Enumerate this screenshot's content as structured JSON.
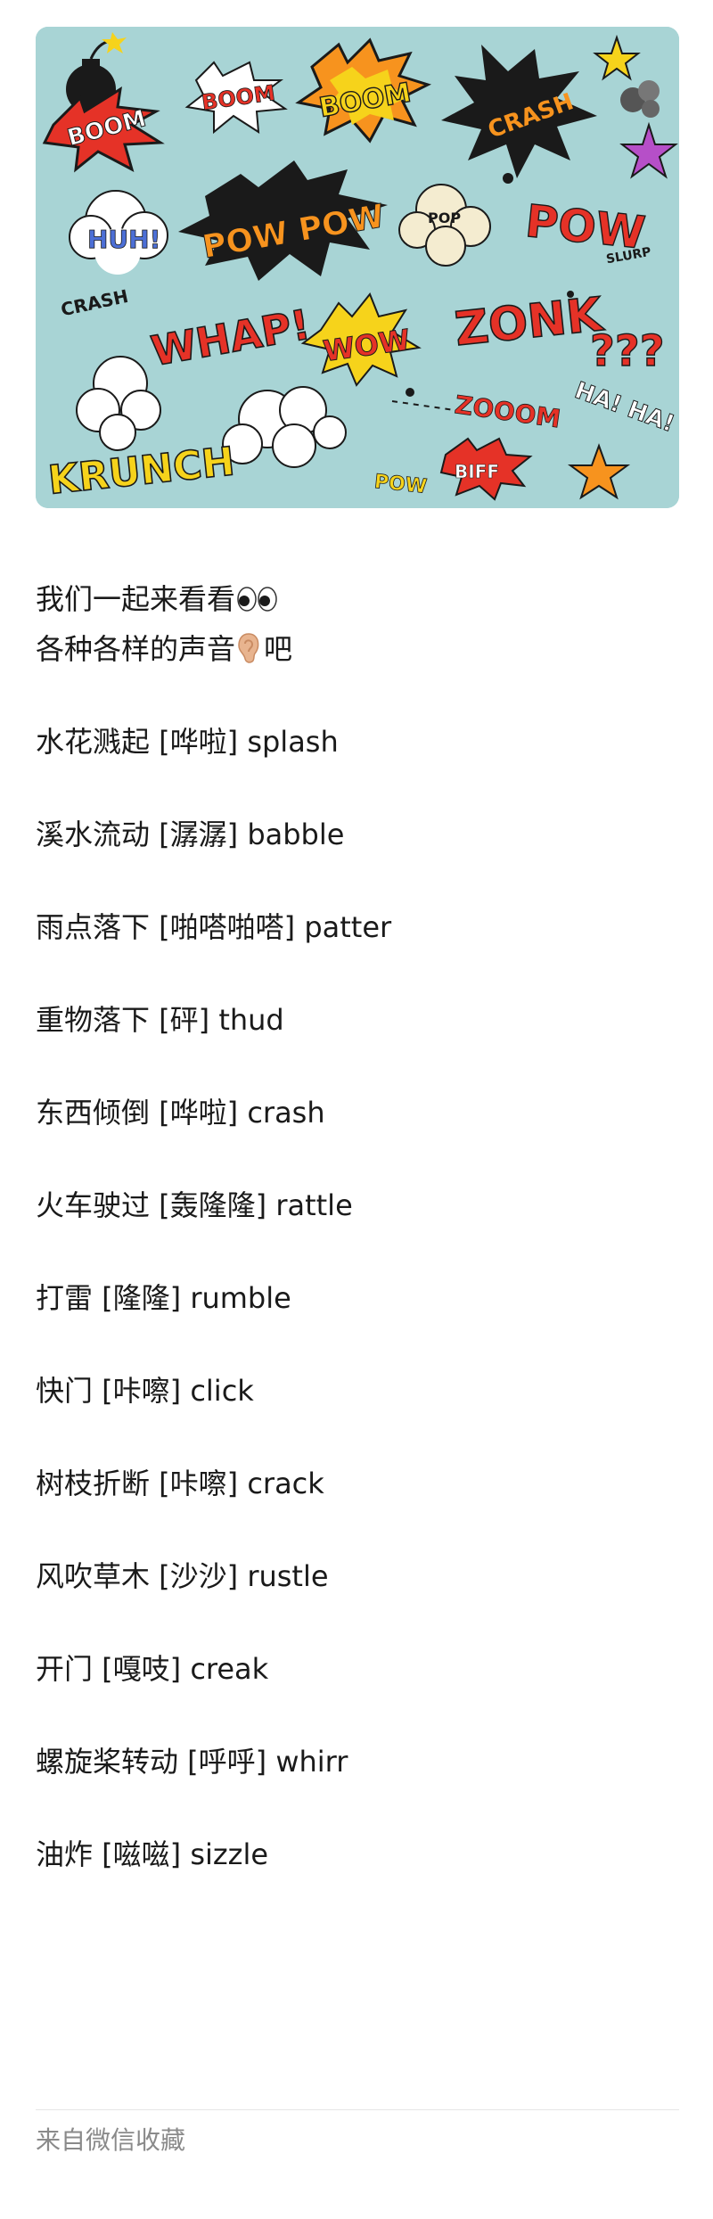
{
  "hero": {
    "comic_words": [
      "BOOM",
      "BOOM",
      "BOOM",
      "CRASH",
      "HUH!",
      "POW POW",
      "POP",
      "POW",
      "SLURP",
      "CRASH",
      "WHAP!",
      "WOW",
      "ZONK",
      "???",
      "ZOOOM",
      "HA! HA! HA!",
      "KRUNCH",
      "BIFF",
      "POW"
    ],
    "colors": {
      "background": "#a8d4d5",
      "red": "#e53227",
      "orange": "#f7931e",
      "yellow": "#f6d31b",
      "black": "#1a1a1a",
      "purple": "#b64fc8",
      "cream": "#f4ecd0"
    }
  },
  "intro": {
    "line1": "我们一起来看看",
    "line1_emoji": "eyes-emoji",
    "line2_before": "各种各样的声音",
    "line2_emoji": "ear-emoji",
    "line2_after": "吧"
  },
  "sounds": [
    "水花溅起 [哗啦] splash",
    "溪水流动 [潺潺] babble",
    "雨点落下 [啪嗒啪嗒] patter",
    "重物落下 [砰] thud",
    "东西倾倒 [哗啦] crash",
    "火车驶过 [轰隆隆] rattle",
    "打雷 [隆隆] rumble",
    "快门 [咔嚓] click",
    "树枝折断 [咔嚓] crack",
    "风吹草木 [沙沙] rustle",
    "开门 [嘎吱] creak",
    "螺旋桨转动 [呼呼] whirr",
    "油炸 [嗞嗞] sizzle"
  ],
  "footer": {
    "source": "来自微信收藏"
  }
}
